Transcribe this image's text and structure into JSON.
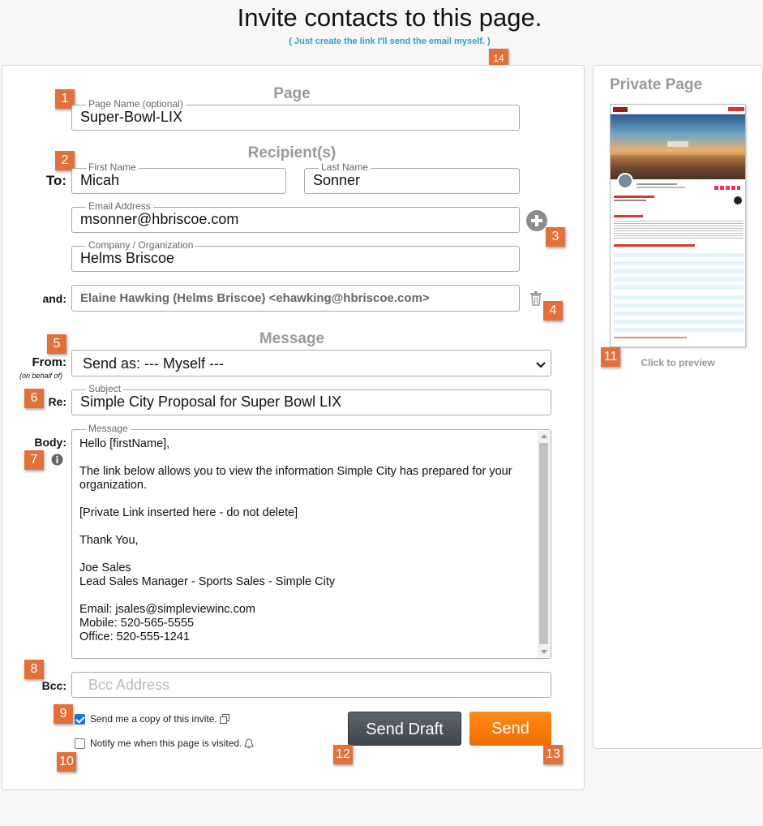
{
  "header": {
    "title": "Invite contacts to this page.",
    "sublink": "( Just create the link I'll send the email myself. )"
  },
  "page_section": {
    "heading": "Page",
    "page_name_legend": "Page Name (optional)",
    "page_name_value": "Super-Bowl-LIX"
  },
  "recipients": {
    "heading": "Recipient(s)",
    "to_label": "To:",
    "first_name_legend": "First Name",
    "first_name_value": "Micah",
    "last_name_legend": "Last Name",
    "last_name_value": "Sonner",
    "email_legend": "Email Address",
    "email_value": "msonner@hbriscoe.com",
    "company_legend": "Company / Organization",
    "company_value": "Helms Briscoe",
    "and_label": "and:",
    "additional_value": "Elaine Hawking (Helms Briscoe) <ehawking@hbriscoe.com>"
  },
  "message": {
    "heading": "Message",
    "from_label": "From:",
    "from_sub": "(on behalf of)",
    "from_value": "Send as: --- Myself ---",
    "re_label": "Re:",
    "subject_legend": "Subject",
    "subject_value": "Simple City Proposal for Super Bowl LIX",
    "body_label": "Body:",
    "body_legend": "Message",
    "body_lines": {
      "greeting": "Hello [firstName],",
      "intro": "The link below allows you to view the information Simple City has prepared for your organization.",
      "link": "[Private Link inserted here - do not delete]",
      "thanks": "Thank You,",
      "name": "Joe Sales",
      "role": "Lead Sales Manager - Sports Sales - Simple City",
      "email": "Email: jsales@simpleviewinc.com",
      "mobile": "Mobile: 520-565-5555",
      "office": "Office: 520-555-1241"
    },
    "bcc_label": "Bcc:",
    "bcc_placeholder": "Bcc Address"
  },
  "options": {
    "copy_label": "Send me a copy of this invite.",
    "copy_checked": true,
    "notify_label": "Notify me when this page is visited.",
    "notify_checked": false
  },
  "buttons": {
    "draft": "Send Draft",
    "send": "Send"
  },
  "preview": {
    "heading": "Private Page",
    "click_label": "Click to preview"
  },
  "badges": [
    "1",
    "2",
    "3",
    "4",
    "5",
    "6",
    "7",
    "8",
    "9",
    "10",
    "11",
    "12",
    "13",
    "14"
  ],
  "colors": {
    "accent": "#2d9ec8",
    "badge": "#e2703a",
    "send": "#f47b0a",
    "draft": "#4a5058"
  },
  "icons": [
    "plus-circle-icon",
    "trash-icon",
    "info-icon",
    "copy-icon",
    "bell-icon",
    "chevron-down-icon"
  ]
}
